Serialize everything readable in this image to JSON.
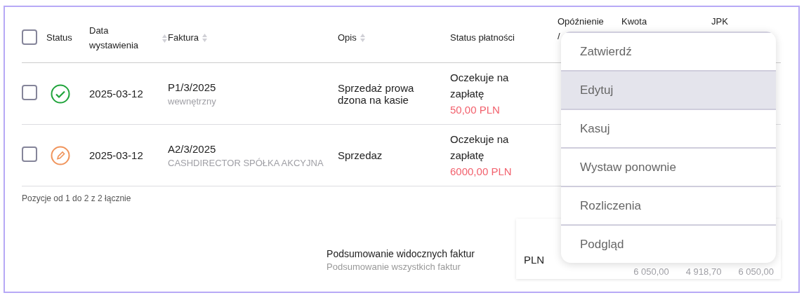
{
  "table": {
    "select_all": {
      "checked": false
    },
    "columns": [
      {
        "label": "Status",
        "sortable": false
      },
      {
        "label": "Data wystawienia",
        "sortable": true
      },
      {
        "label": "Faktura",
        "sortable": true
      },
      {
        "label": "Opis",
        "sortable": true
      },
      {
        "label": "Status płatności",
        "sortable": false
      },
      {
        "label": "Opóźnienie\n/",
        "sortable": false
      },
      {
        "label": "Kwota",
        "sortable": false
      },
      {
        "label": "JPK",
        "sortable": false
      }
    ],
    "rows": [
      {
        "checked": false,
        "kind": "approved",
        "date": "2025-03-12",
        "invoice": "P1/3/2025",
        "invoice_note": "wewnętrzny",
        "description": "Sprzedaż prowa dzona na kasie",
        "payment_status": "Oczekuje na zapłatę",
        "amount_due": "50,00 PLN"
      },
      {
        "checked": false,
        "kind": "draft",
        "date": "2025-03-12",
        "invoice": "A2/3/2025",
        "invoice_note": "CASHDIRECTOR SPÓŁKA AKCYJNA",
        "description": "Sprzedaz",
        "payment_status": "Oczekuje na zapłatę",
        "amount_due": "6000,00 PLN"
      }
    ],
    "footer": "Pozycje od 1 do 2 z 2 łącznie"
  },
  "summary": {
    "visible_label": "Podsumowanie widocznych faktur",
    "all_label": "Podsumowanie wszystkich faktur",
    "currency": "PLN",
    "totals": [
      "6 050,00",
      "4 918,70",
      "6 050,00"
    ]
  },
  "menu": {
    "items": [
      {
        "label": "Zatwierdź",
        "selected": false
      },
      {
        "label": "Edytuj",
        "selected": true
      },
      {
        "label": "Kasuj",
        "selected": false
      },
      {
        "label": "Wystaw ponownie",
        "selected": false
      },
      {
        "label": "Rozliczenia",
        "selected": false
      },
      {
        "label": "Podgląd",
        "selected": false
      }
    ]
  }
}
